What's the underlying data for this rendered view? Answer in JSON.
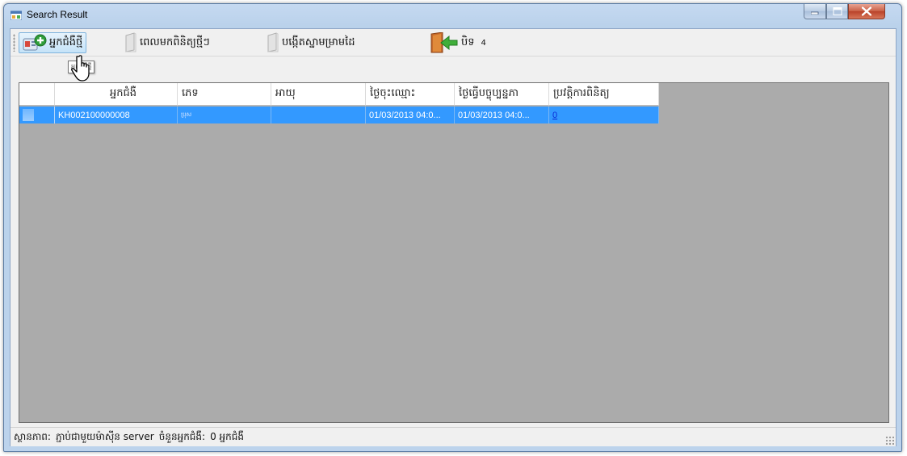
{
  "window": {
    "title": "Search Result"
  },
  "toolbar": {
    "new_patient_label": "អ្នកជំងឺថ្មី",
    "visit_label": "ពេលមកពិនិត្យថ្មីៗ",
    "create_form_label": "បង្កើតស្នាមម្រាមដៃ",
    "close_label": "បិទ",
    "count_label": "4"
  },
  "tooltip": {
    "text": "អ្នកជំងឺថ្មី"
  },
  "grid": {
    "columns": [
      "",
      "អ្នកជំងឺ",
      "ភេទ",
      "អាយុ",
      "ថ្ងៃចុះឈ្មោះ",
      "ថ្ងៃធ្វើបច្ចុប្បន្នភា",
      "ប្រវត្តិការពិនិត្យ"
    ],
    "rows": [
      {
        "patient_id": "KH002100000008",
        "sex": "ប្រុស",
        "age": "",
        "registered": "01/03/2013 04:0...",
        "updated": "01/03/2013 04:0...",
        "history": "0"
      }
    ]
  },
  "status": {
    "state_label": "ស្ថានភាព:",
    "state_value": "ភ្ជាប់ជាមួយម៉ាស៊ីន server",
    "count_label": "ចំនួនអ្នកជំងឺ:",
    "count_value": "0 អ្នកជំងឺ"
  },
  "colors": {
    "selection": "#3399ff",
    "grid_background": "#ababab",
    "link": "#0a2bd6"
  }
}
